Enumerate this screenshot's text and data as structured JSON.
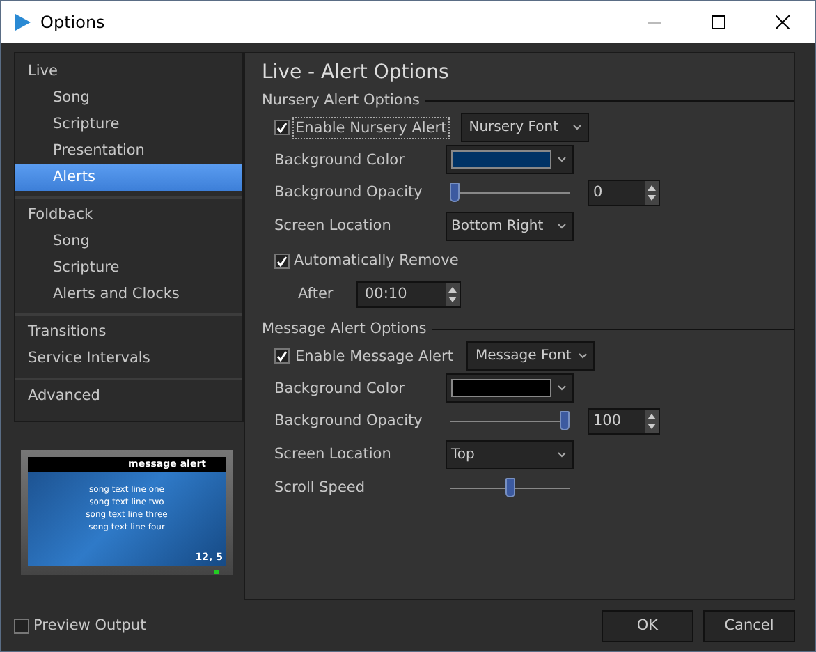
{
  "window": {
    "title": "Options"
  },
  "sidebar": {
    "groups": [
      {
        "items": [
          {
            "label": "Live",
            "selected": false,
            "children": [
              {
                "label": "Song",
                "selected": false
              },
              {
                "label": "Scripture",
                "selected": false
              },
              {
                "label": "Presentation",
                "selected": false
              },
              {
                "label": "Alerts",
                "selected": true
              }
            ]
          }
        ]
      },
      {
        "items": [
          {
            "label": "Foldback",
            "selected": false,
            "children": [
              {
                "label": "Song",
                "selected": false
              },
              {
                "label": "Scripture",
                "selected": false
              },
              {
                "label": "Alerts and Clocks",
                "selected": false
              }
            ]
          }
        ]
      },
      {
        "items": [
          {
            "label": "Transitions",
            "selected": false
          },
          {
            "label": "Service Intervals",
            "selected": false
          }
        ]
      },
      {
        "items": [
          {
            "label": "Advanced",
            "selected": false
          }
        ]
      }
    ]
  },
  "preview": {
    "alert": "message alert",
    "lines": [
      "song text line one",
      "song text line two",
      "song text line three",
      "song text line four"
    ],
    "counter": "12, 5"
  },
  "preview_output": {
    "label": "Preview Output",
    "checked": false
  },
  "panel": {
    "title": "Live - Alert Options",
    "sections": [
      {
        "title": "Nursery Alert Options",
        "rows": [
          {
            "kind": "checkbutton",
            "label": "Enable Nursery Alert",
            "checked": true,
            "focused": true,
            "button": "Nursery Font"
          },
          {
            "kind": "color",
            "label": "Background Color",
            "color": "#003366"
          },
          {
            "kind": "slider",
            "label": "Background Opacity",
            "level": 0,
            "value": "0"
          },
          {
            "kind": "dropdown",
            "label": "Screen Location",
            "value": "Bottom Right"
          },
          {
            "kind": "checkbox",
            "label": "Automatically Remove",
            "checked": true
          },
          {
            "kind": "spin",
            "label": "After",
            "value": "00:10"
          }
        ]
      },
      {
        "title": "Message Alert Options",
        "rows": [
          {
            "kind": "checkbutton",
            "label": "Enable Message Alert",
            "checked": true,
            "focused": false,
            "button": "Message Font"
          },
          {
            "kind": "color",
            "label": "Background Color",
            "color": "#000000"
          },
          {
            "kind": "slider",
            "label": "Background Opacity",
            "level": 1,
            "value": "100"
          },
          {
            "kind": "dropdown",
            "label": "Screen Location",
            "value": "Top"
          },
          {
            "kind": "slider",
            "label": "Scroll Speed",
            "level": 0.5
          }
        ]
      }
    ]
  },
  "buttons": [
    "OK",
    "Cancel"
  ]
}
